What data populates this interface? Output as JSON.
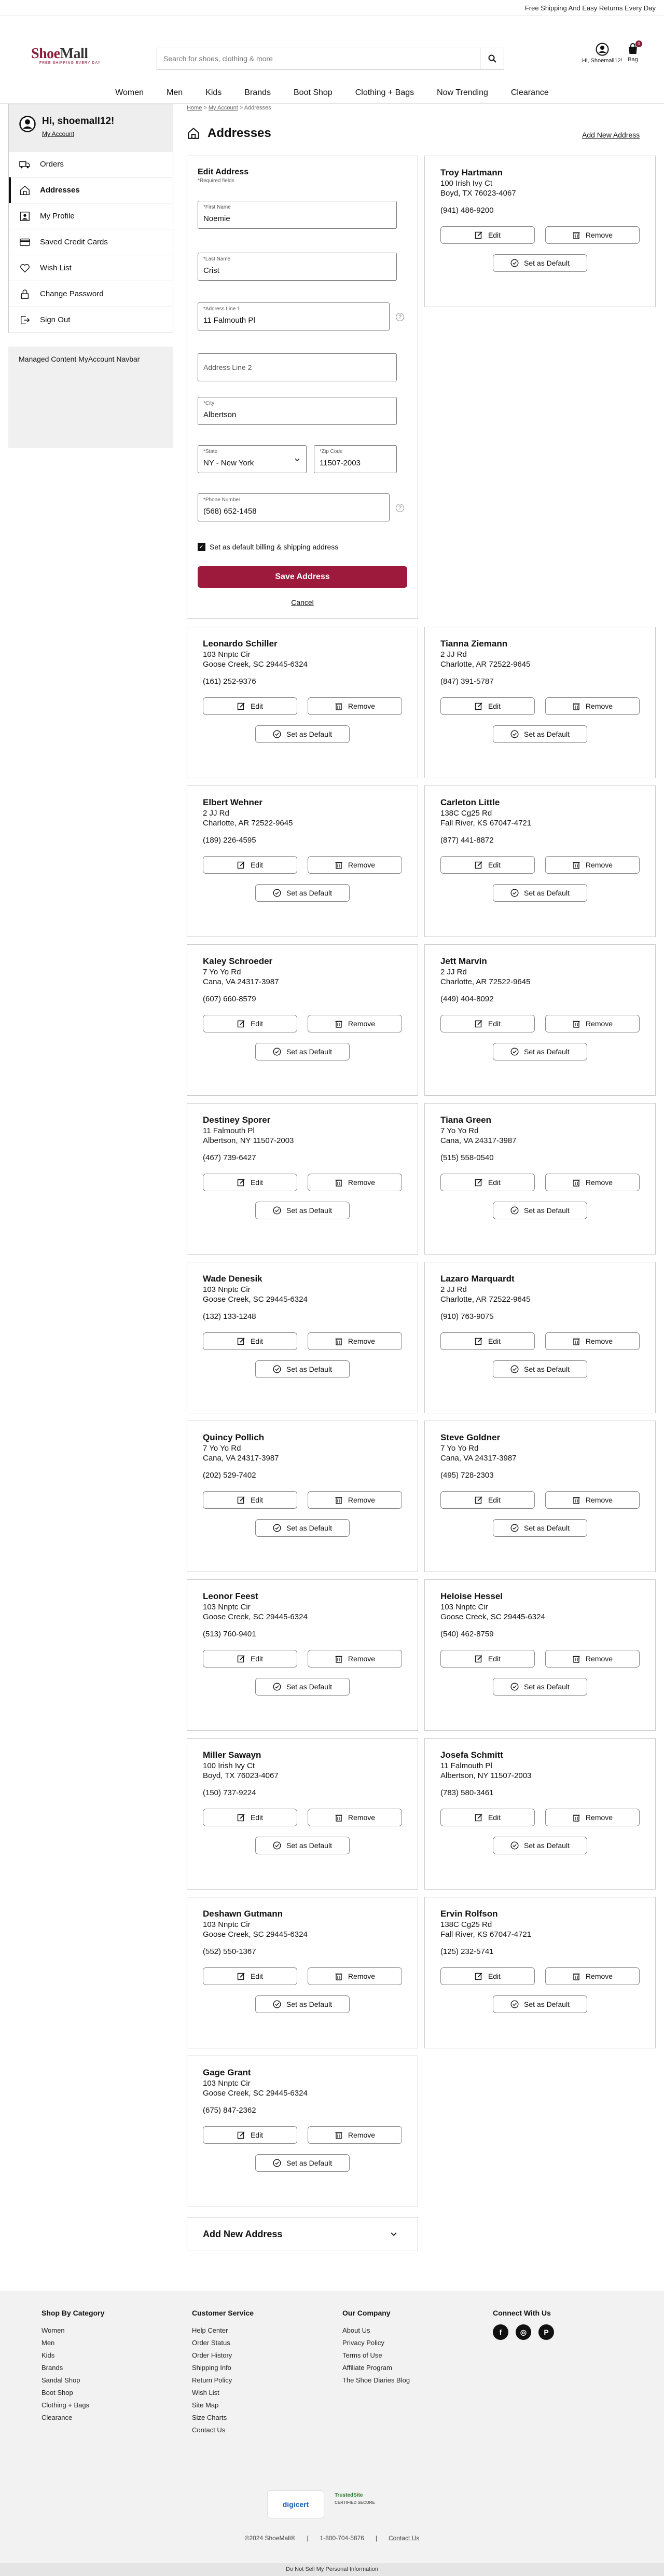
{
  "promo": "Free Shipping And Easy Returns Every Day",
  "brand": {
    "name_a": "Shoe",
    "name_b": "Mall",
    "tagline": "FREE SHIPPING EVERY DAY"
  },
  "search": {
    "placeholder": "Search for shoes, clothing & more"
  },
  "account_label": "Hi, Shoemall12!",
  "bag": {
    "label": "Bag",
    "count": "0"
  },
  "nav": [
    "Women",
    "Men",
    "Kids",
    "Brands",
    "Boot Shop",
    "Clothing + Bags",
    "Now Trending",
    "Clearance"
  ],
  "sidebar": {
    "greeting": "Hi, shoemall12!",
    "my_account": "My Account",
    "items": [
      "Orders",
      "Addresses",
      "My Profile",
      "Saved Credit Cards",
      "Wish List",
      "Change Password",
      "Sign Out"
    ],
    "managed": "Managed Content MyAccount Navbar"
  },
  "breadcrumb": {
    "home": "Home",
    "my_account": "My Account",
    "current": "Addresses"
  },
  "page": {
    "title": "Addresses",
    "add_new_link": "Add New Address"
  },
  "edit_form": {
    "title": "Edit Address",
    "required_note": "*Required fields",
    "first_name": {
      "label": "*First Name",
      "value": "Noemie"
    },
    "last_name": {
      "label": "*Last Name",
      "value": "Crist"
    },
    "address1": {
      "label": "*Address Line 1",
      "value": "11 Falmouth Pl"
    },
    "address2": {
      "placeholder": "Address Line 2"
    },
    "city": {
      "label": "*City",
      "value": "Albertson"
    },
    "state": {
      "label": "*State",
      "value": "NY - New York"
    },
    "zip": {
      "label": "*Zip Code",
      "value": "11507-2003"
    },
    "phone": {
      "label": "*Phone Number",
      "value": "(568) 652-1458"
    },
    "default_label": "Set as default billing & shipping address",
    "save": "Save Address",
    "cancel": "Cancel"
  },
  "buttons": {
    "edit": "Edit",
    "remove": "Remove",
    "set_default": "Set as Default"
  },
  "addresses": [
    {
      "name": "Troy Hartmann",
      "street": "100 Irish Ivy Ct",
      "city": "Boyd, TX 76023-4067",
      "phone": "(941) 486-9200"
    },
    {
      "name": "Leonardo Schiller",
      "street": "103 Nnptc Cir",
      "city": "Goose Creek, SC 29445-6324",
      "phone": "(161) 252-9376"
    },
    {
      "name": "Tianna Ziemann",
      "street": "2 JJ Rd",
      "city": "Charlotte, AR 72522-9645",
      "phone": "(847) 391-5787"
    },
    {
      "name": "Elbert Wehner",
      "street": "2 JJ Rd",
      "city": "Charlotte, AR 72522-9645",
      "phone": "(189) 226-4595"
    },
    {
      "name": "Carleton Little",
      "street": "138C Cg25 Rd",
      "city": "Fall River, KS 67047-4721",
      "phone": "(877) 441-8872"
    },
    {
      "name": "Kaley Schroeder",
      "street": "7 Yo Yo Rd",
      "city": "Cana, VA 24317-3987",
      "phone": "(607) 660-8579"
    },
    {
      "name": "Jett Marvin",
      "street": "2 JJ Rd",
      "city": "Charlotte, AR 72522-9645",
      "phone": "(449) 404-8092"
    },
    {
      "name": "Destiney Sporer",
      "street": "11 Falmouth Pl",
      "city": "Albertson, NY 11507-2003",
      "phone": "(467) 739-6427"
    },
    {
      "name": "Tiana Green",
      "street": "7 Yo Yo Rd",
      "city": "Cana, VA 24317-3987",
      "phone": "(515) 558-0540"
    },
    {
      "name": "Wade Denesik",
      "street": "103 Nnptc Cir",
      "city": "Goose Creek, SC 29445-6324",
      "phone": "(132) 133-1248"
    },
    {
      "name": "Lazaro Marquardt",
      "street": "2 JJ Rd",
      "city": "Charlotte, AR 72522-9645",
      "phone": "(910) 763-9075"
    },
    {
      "name": "Quincy Pollich",
      "street": "7 Yo Yo Rd",
      "city": "Cana, VA 24317-3987",
      "phone": "(202) 529-7402"
    },
    {
      "name": "Steve Goldner",
      "street": "7 Yo Yo Rd",
      "city": "Cana, VA 24317-3987",
      "phone": "(495) 728-2303"
    },
    {
      "name": "Leonor Feest",
      "street": "103 Nnptc Cir",
      "city": "Goose Creek, SC 29445-6324",
      "phone": "(513) 760-9401"
    },
    {
      "name": "Heloise Hessel",
      "street": "103 Nnptc Cir",
      "city": "Goose Creek, SC 29445-6324",
      "phone": "(540) 462-8759"
    },
    {
      "name": "Miller Sawayn",
      "street": "100 Irish Ivy Ct",
      "city": "Boyd, TX 76023-4067",
      "phone": "(150) 737-9224"
    },
    {
      "name": "Josefa Schmitt",
      "street": "11 Falmouth Pl",
      "city": "Albertson, NY 11507-2003",
      "phone": "(783) 580-3461"
    },
    {
      "name": "Deshawn Gutmann",
      "street": "103 Nnptc Cir",
      "city": "Goose Creek, SC 29445-6324",
      "phone": "(552) 550-1367"
    },
    {
      "name": "Ervin Rolfson",
      "street": "138C Cg25 Rd",
      "city": "Fall River, KS 67047-4721",
      "phone": "(125) 232-5741"
    },
    {
      "name": "Gage Grant",
      "street": "103 Nnptc Cir",
      "city": "Goose Creek, SC 29445-6324",
      "phone": "(675) 847-2362"
    }
  ],
  "add_new_accordion": "Add New Address",
  "footer": {
    "shop": {
      "title": "Shop By Category",
      "links": [
        "Women",
        "Men",
        "Kids",
        "Brands",
        "Sandal Shop",
        "Boot Shop",
        "Clothing + Bags",
        "Clearance"
      ]
    },
    "service": {
      "title": "Customer Service",
      "links": [
        "Help Center",
        "Order Status",
        "Order History",
        "Shipping Info",
        "Return Policy",
        "Wish List",
        "Site Map",
        "Size Charts",
        "Contact Us"
      ]
    },
    "company": {
      "title": "Our Company",
      "links": [
        "About Us",
        "Privacy Policy",
        "Terms of Use",
        "Affiliate Program",
        "The Shoe Diaries Blog"
      ]
    },
    "connect": "Connect With Us",
    "digicert": "digicert",
    "trusted": "TrustedSite",
    "trusted_sub": "CERTIFIED SECURE",
    "copyright": "©2024 ShoeMall®",
    "phone": "1-800-704-5876",
    "contact": "Contact Us",
    "do_not_sell": "Do Not Sell My Personal Information"
  },
  "colors": {
    "accent": "#9e1a3c",
    "border": "#cccccc"
  }
}
